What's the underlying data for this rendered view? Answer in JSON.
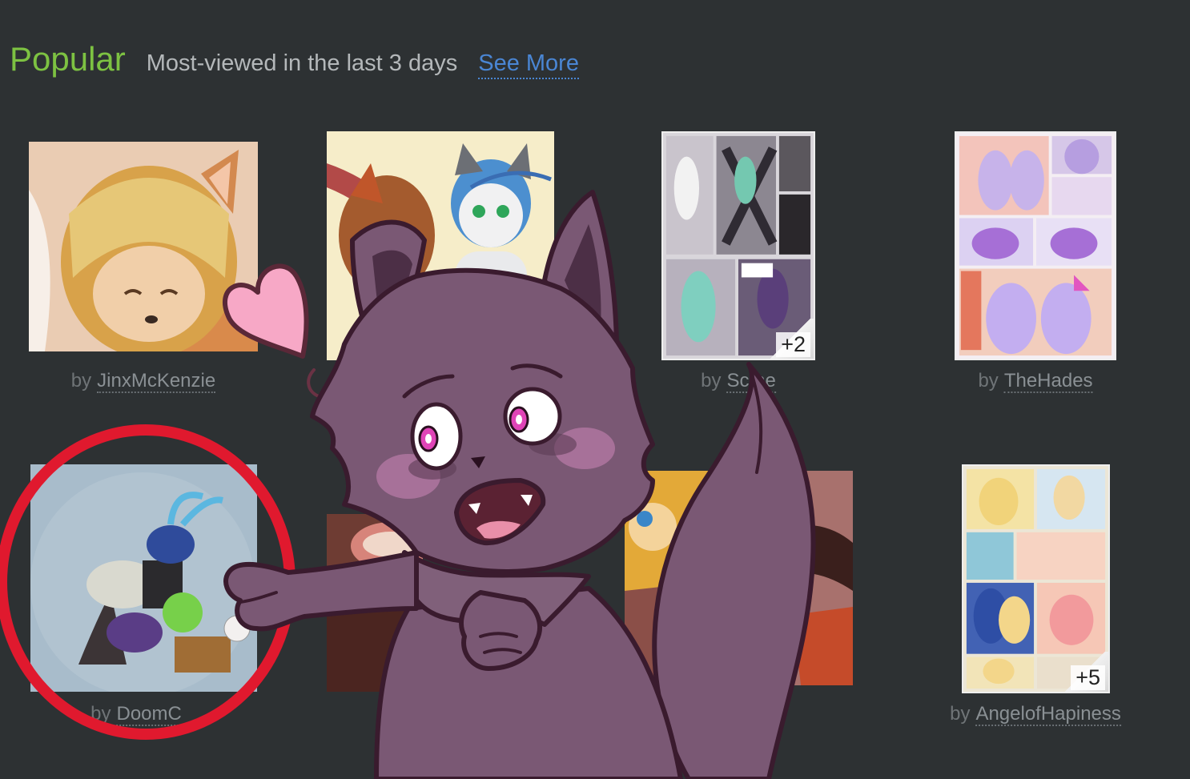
{
  "header": {
    "title": "Popular",
    "subtitle": "Most-viewed in the last 3 days",
    "see_more": "See More"
  },
  "colors": {
    "background": "#2d3133",
    "title": "#7dc242",
    "link": "#4a86d4",
    "highlight_circle": "#e0192e",
    "character_fur": "#7a5874"
  },
  "gallery": {
    "by_label": "by",
    "items": [
      {
        "artist": "JinxMcKenzie",
        "badge": ""
      },
      {
        "artist": "",
        "badge": ""
      },
      {
        "artist": "Sc   ne",
        "badge": "+2"
      },
      {
        "artist": "TheHades",
        "badge": ""
      },
      {
        "artist": "DoomC",
        "badge": ""
      },
      {
        "artist": "",
        "badge": ""
      },
      {
        "artist": "",
        "badge": ""
      },
      {
        "artist": "AngelofHapiness",
        "badge": "+5"
      }
    ]
  },
  "overlay": {
    "character": "purple-wolf-mascot",
    "heart_icon": "heart-icon",
    "annotation": "red-highlight-circle"
  }
}
